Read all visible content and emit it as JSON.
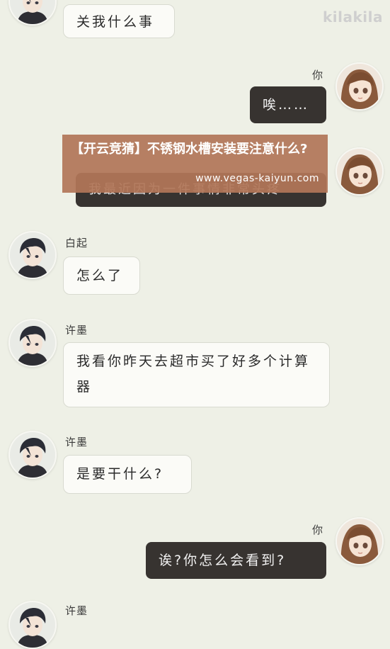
{
  "watermark": {
    "brand": "kilakila"
  },
  "messages": [
    {
      "speaker": "",
      "text": "关我什么事"
    },
    {
      "speaker": "你",
      "text": "唉……"
    },
    {
      "speaker": "",
      "text": "我最近因为一件事情非常头疼"
    },
    {
      "speaker": "白起",
      "text": "怎么了"
    },
    {
      "speaker": "许墨",
      "text": "我看你昨天去超市买了好多个计算器"
    },
    {
      "speaker": "许墨",
      "text": "是要干什么?"
    },
    {
      "speaker": "你",
      "text": "诶?你怎么会看到?"
    },
    {
      "speaker": "许墨",
      "text": ""
    }
  ],
  "overlay": {
    "title": "【开云竞猜】不锈钢水槽安装要注意什么?",
    "url": "www.vegas-kaiyun.com"
  },
  "colors": {
    "background": "#eef0e6",
    "left_bubble": "#fbfbf7",
    "right_bubble": "#373330",
    "overlay": "#b27658"
  },
  "icons": {
    "avatar_boy": "avatar-icon",
    "avatar_girl": "avatar-icon"
  }
}
